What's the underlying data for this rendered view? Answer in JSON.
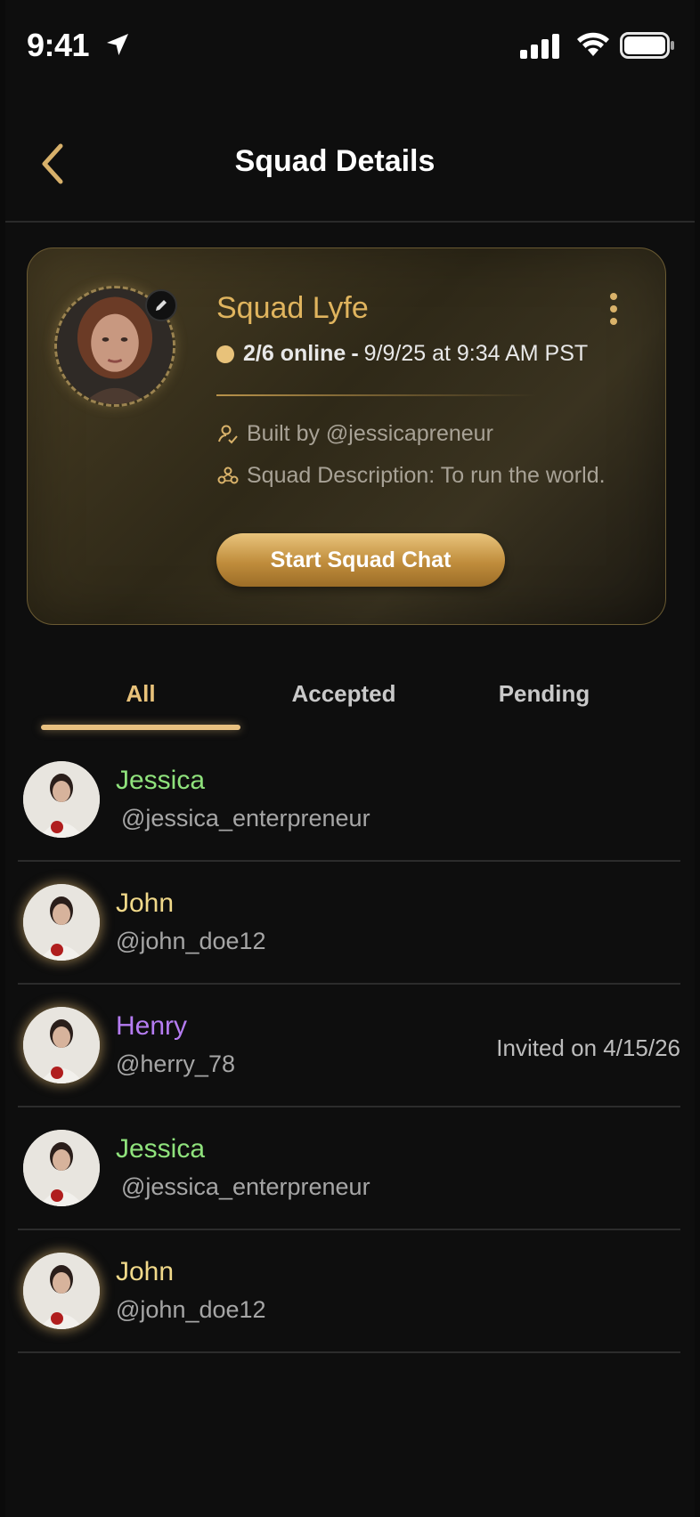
{
  "status_bar": {
    "time": "9:41"
  },
  "header": {
    "title": "Squad Details"
  },
  "squad": {
    "name": "Squad Lyfe",
    "online_count": "2/6 online",
    "separator": "-",
    "last_active": "9/9/25 at 9:34 AM PST",
    "built_by": "Built by @jessicapreneur",
    "description": "Squad Description: To run the world.",
    "chat_button_label": "Start Squad Chat"
  },
  "tabs": {
    "all": "All",
    "accepted": "Accepted",
    "pending": "Pending",
    "selected": "All"
  },
  "members": [
    {
      "name": "Jessica",
      "handle": "@jessica_enterpreneur",
      "name_color": "#8fe27c",
      "invite": ""
    },
    {
      "name": "John",
      "handle": "@john_doe12",
      "name_color": "#f1d98a",
      "invite": ""
    },
    {
      "name": "Henry",
      "handle": "@herry_78",
      "name_color": "#b57cf2",
      "invite": "Invited on 4/15/26"
    },
    {
      "name": "Jessica",
      "handle": "@jessica_enterpreneur",
      "name_color": "#8fe27c",
      "invite": ""
    },
    {
      "name": "John",
      "handle": "@john_doe12",
      "name_color": "#f1d98a",
      "invite": ""
    }
  ],
  "colors": {
    "accent_gold": "#e0b45e",
    "background": "#0e0e0e"
  },
  "icons": {
    "location": "location-arrow-icon",
    "signal": "cellular-signal-icon",
    "wifi": "wifi-icon",
    "battery": "battery-icon",
    "back": "chevron-left-icon",
    "edit": "pencil-icon",
    "more": "more-vertical-icon",
    "builder": "user-check-icon",
    "description": "squad-group-icon"
  }
}
